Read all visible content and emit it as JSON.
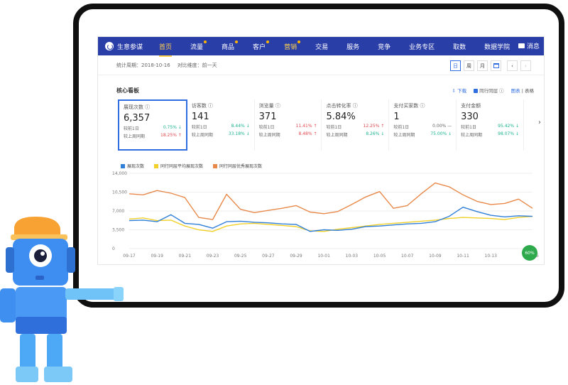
{
  "nav": {
    "brand": "生意参谋",
    "items": [
      {
        "label": "首页",
        "active": true,
        "dot": false
      },
      {
        "label": "流量",
        "active": false,
        "dot": true
      },
      {
        "label": "商品",
        "active": false,
        "dot": true
      },
      {
        "label": "客户",
        "active": false,
        "dot": true
      },
      {
        "label": "营销",
        "active": false,
        "dot": true,
        "highlight": true
      },
      {
        "label": "交易",
        "active": false,
        "dot": false
      },
      {
        "label": "服务",
        "active": false,
        "dot": false
      },
      {
        "label": "竞争",
        "active": false,
        "dot": false
      },
      {
        "label": "业务专区",
        "active": false,
        "dot": false
      },
      {
        "label": "取数",
        "active": false,
        "dot": false
      },
      {
        "label": "数据学院",
        "active": false,
        "dot": false
      }
    ],
    "messages": "消息"
  },
  "filters": {
    "period_label": "统计周期：2018-10-16",
    "compare_label": "对比维度：前一天"
  },
  "period_buttons": {
    "day": "日",
    "week": "周",
    "month": "月"
  },
  "board": {
    "title": "核心看板",
    "download": "下载",
    "peer_avg": "同行同层",
    "chart_tab": "图表",
    "table_tab": "表格"
  },
  "metrics": [
    {
      "label": "展现次数",
      "value": "6,357",
      "r1_label": "较前1日",
      "r1_value": "0.75%",
      "r1_dir": "down",
      "r2_label": "较上周同期",
      "r2_value": "18.25%",
      "r2_dir": "up"
    },
    {
      "label": "访客数",
      "value": "141",
      "r1_label": "较前1日",
      "r1_value": "8.44%",
      "r1_dir": "down",
      "r2_label": "较上周同期",
      "r2_value": "33.18%",
      "r2_dir": "down"
    },
    {
      "label": "浏览量",
      "value": "371",
      "r1_label": "较前1日",
      "r1_value": "11.41%",
      "r1_dir": "up",
      "r2_label": "较上周同期",
      "r2_value": "8.48%",
      "r2_dir": "up"
    },
    {
      "label": "点击转化率",
      "value": "5.84%",
      "r1_label": "较前1日",
      "r1_value": "12.25%",
      "r1_dir": "up",
      "r2_label": "较上周同期",
      "r2_value": "8.26%",
      "r2_dir": "down"
    },
    {
      "label": "支付买家数",
      "value": "1",
      "r1_label": "较前1日",
      "r1_value": "0.00% —",
      "r1_dir": "none",
      "r2_label": "较上周同期",
      "r2_value": "75.00%",
      "r2_dir": "down"
    },
    {
      "label": "支付金额",
      "value": "330",
      "r1_label": "较前1日",
      "r1_value": "95.42%",
      "r1_dir": "down",
      "r2_label": "较上周同期",
      "r2_value": "98.07%",
      "r2_dir": "down"
    }
  ],
  "colors": {
    "nav_bg": "#2a3ea8",
    "blue": "#2f7ed8",
    "yellow": "#f2d02a",
    "orange": "#e8894a",
    "up": "#e0484f",
    "down": "#1bb38f"
  },
  "badge": "60%",
  "chart_data": {
    "type": "line",
    "yticks": [
      0,
      3500,
      7000,
      10500,
      14000
    ],
    "ylim": [
      0,
      14000
    ],
    "x": [
      "09-17",
      "09-18",
      "09-19",
      "09-20",
      "09-21",
      "09-22",
      "09-23",
      "09-24",
      "09-25",
      "09-26",
      "09-27",
      "09-28",
      "09-29",
      "09-30",
      "10-01",
      "10-02",
      "10-03",
      "10-04",
      "10-05",
      "10-06",
      "10-07",
      "10-08",
      "10-09",
      "10-10",
      "10-11",
      "10-12",
      "10-13",
      "10-14",
      "10-15",
      "10-16"
    ],
    "xticks": [
      "09-17",
      "09-19",
      "09-21",
      "09-23",
      "09-25",
      "09-27",
      "09-29",
      "10-01",
      "10-03",
      "10-05",
      "10-07",
      "10-09",
      "10-11",
      "10-13",
      "10-16"
    ],
    "series": [
      {
        "name": "展现次数",
        "color": "#2f7ed8",
        "values": [
          5200,
          5300,
          5000,
          6300,
          4700,
          4500,
          3800,
          5000,
          5100,
          4900,
          4800,
          4600,
          4500,
          3200,
          3500,
          3400,
          3600,
          4100,
          4200,
          4400,
          4600,
          4700,
          5000,
          6000,
          7700,
          6900,
          6200,
          5900,
          6100,
          6000
        ]
      },
      {
        "name": "同行同层平均展现次数",
        "color": "#f2d02a",
        "values": [
          5500,
          5700,
          5200,
          5300,
          4200,
          3500,
          3200,
          4200,
          4600,
          4700,
          4500,
          4300,
          4100,
          3300,
          3200,
          3600,
          3900,
          4200,
          4500,
          4700,
          4900,
          5100,
          5300,
          5600,
          5800,
          5700,
          5600,
          5400,
          5800,
          6000
        ]
      },
      {
        "name": "同行同层优秀展现次数",
        "color": "#e8894a",
        "values": [
          10200,
          10000,
          10800,
          10300,
          9500,
          5800,
          5400,
          10100,
          7300,
          6700,
          7100,
          7500,
          8000,
          6800,
          6500,
          6900,
          8200,
          9600,
          10600,
          7500,
          8000,
          10200,
          12200,
          11500,
          10000,
          8800,
          8200,
          8400,
          9200,
          7500
        ]
      }
    ]
  }
}
